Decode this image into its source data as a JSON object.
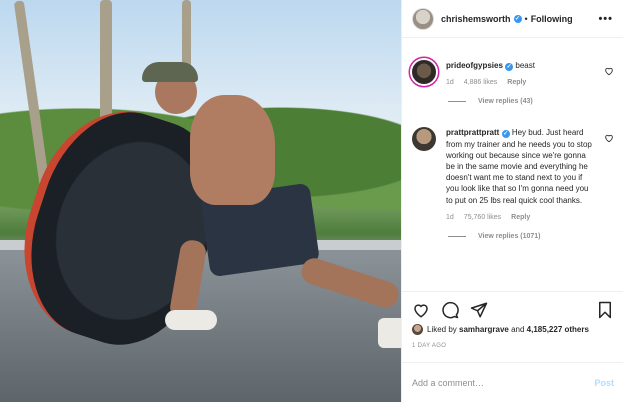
{
  "post": {
    "author": "chrishemsworth",
    "following_label": "Following",
    "more_icon": "more-icon"
  },
  "comments": [
    {
      "username": "prideofgypsies",
      "text": "beast",
      "age": "1d",
      "likes": "4,886 likes",
      "reply_label": "Reply",
      "view_replies": "View replies (43)"
    },
    {
      "username": "prattprattpratt",
      "text": "Hey bud. Just heard from my trainer and he needs you to stop working out because since we're gonna be in the same movie and everything he doesn't want me to stand next to you if you look like that so I'm gonna need you to put on 25 lbs real quick cool thanks.",
      "age": "1d",
      "likes": "75,760 likes",
      "reply_label": "Reply",
      "view_replies": "View replies (1071)"
    }
  ],
  "actions": {
    "icons": [
      "heart-icon",
      "comment-icon",
      "share-icon",
      "bookmark-icon"
    ],
    "liked_by_prefix": "Liked by",
    "liked_by_user": "samhargrave",
    "liked_by_and": "and",
    "liked_by_count": "4,185,227 others",
    "time": "1 DAY AGO"
  },
  "compose": {
    "placeholder": "Add a comment…",
    "post_label": "Post"
  },
  "colors": {
    "verified": "#3897f0",
    "muted": "#8e8e8e",
    "post_disabled": "#b2dffc",
    "story_ring": "#d6249f"
  }
}
